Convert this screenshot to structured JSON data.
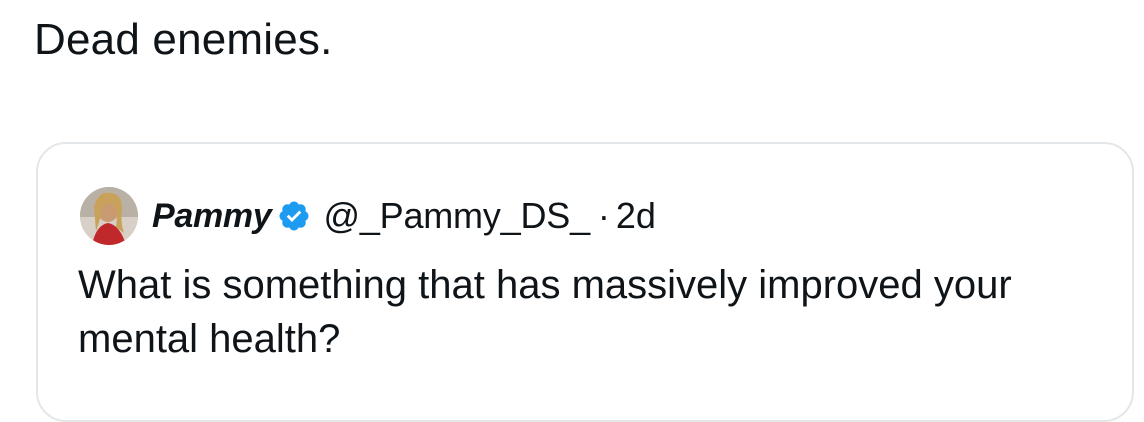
{
  "post": {
    "text": "Dead enemies."
  },
  "quoted_post": {
    "author": {
      "display_name": "Pammy",
      "handle": "@_Pammy_DS_",
      "verified": true,
      "avatar_icon": "profile-photo"
    },
    "separator": "·",
    "time": "2d",
    "text": "What is something that has massively improved your mental health?"
  },
  "colors": {
    "text": "#0f1419",
    "border": "#e3e7ea",
    "verified_badge": "#1d9bf0"
  }
}
